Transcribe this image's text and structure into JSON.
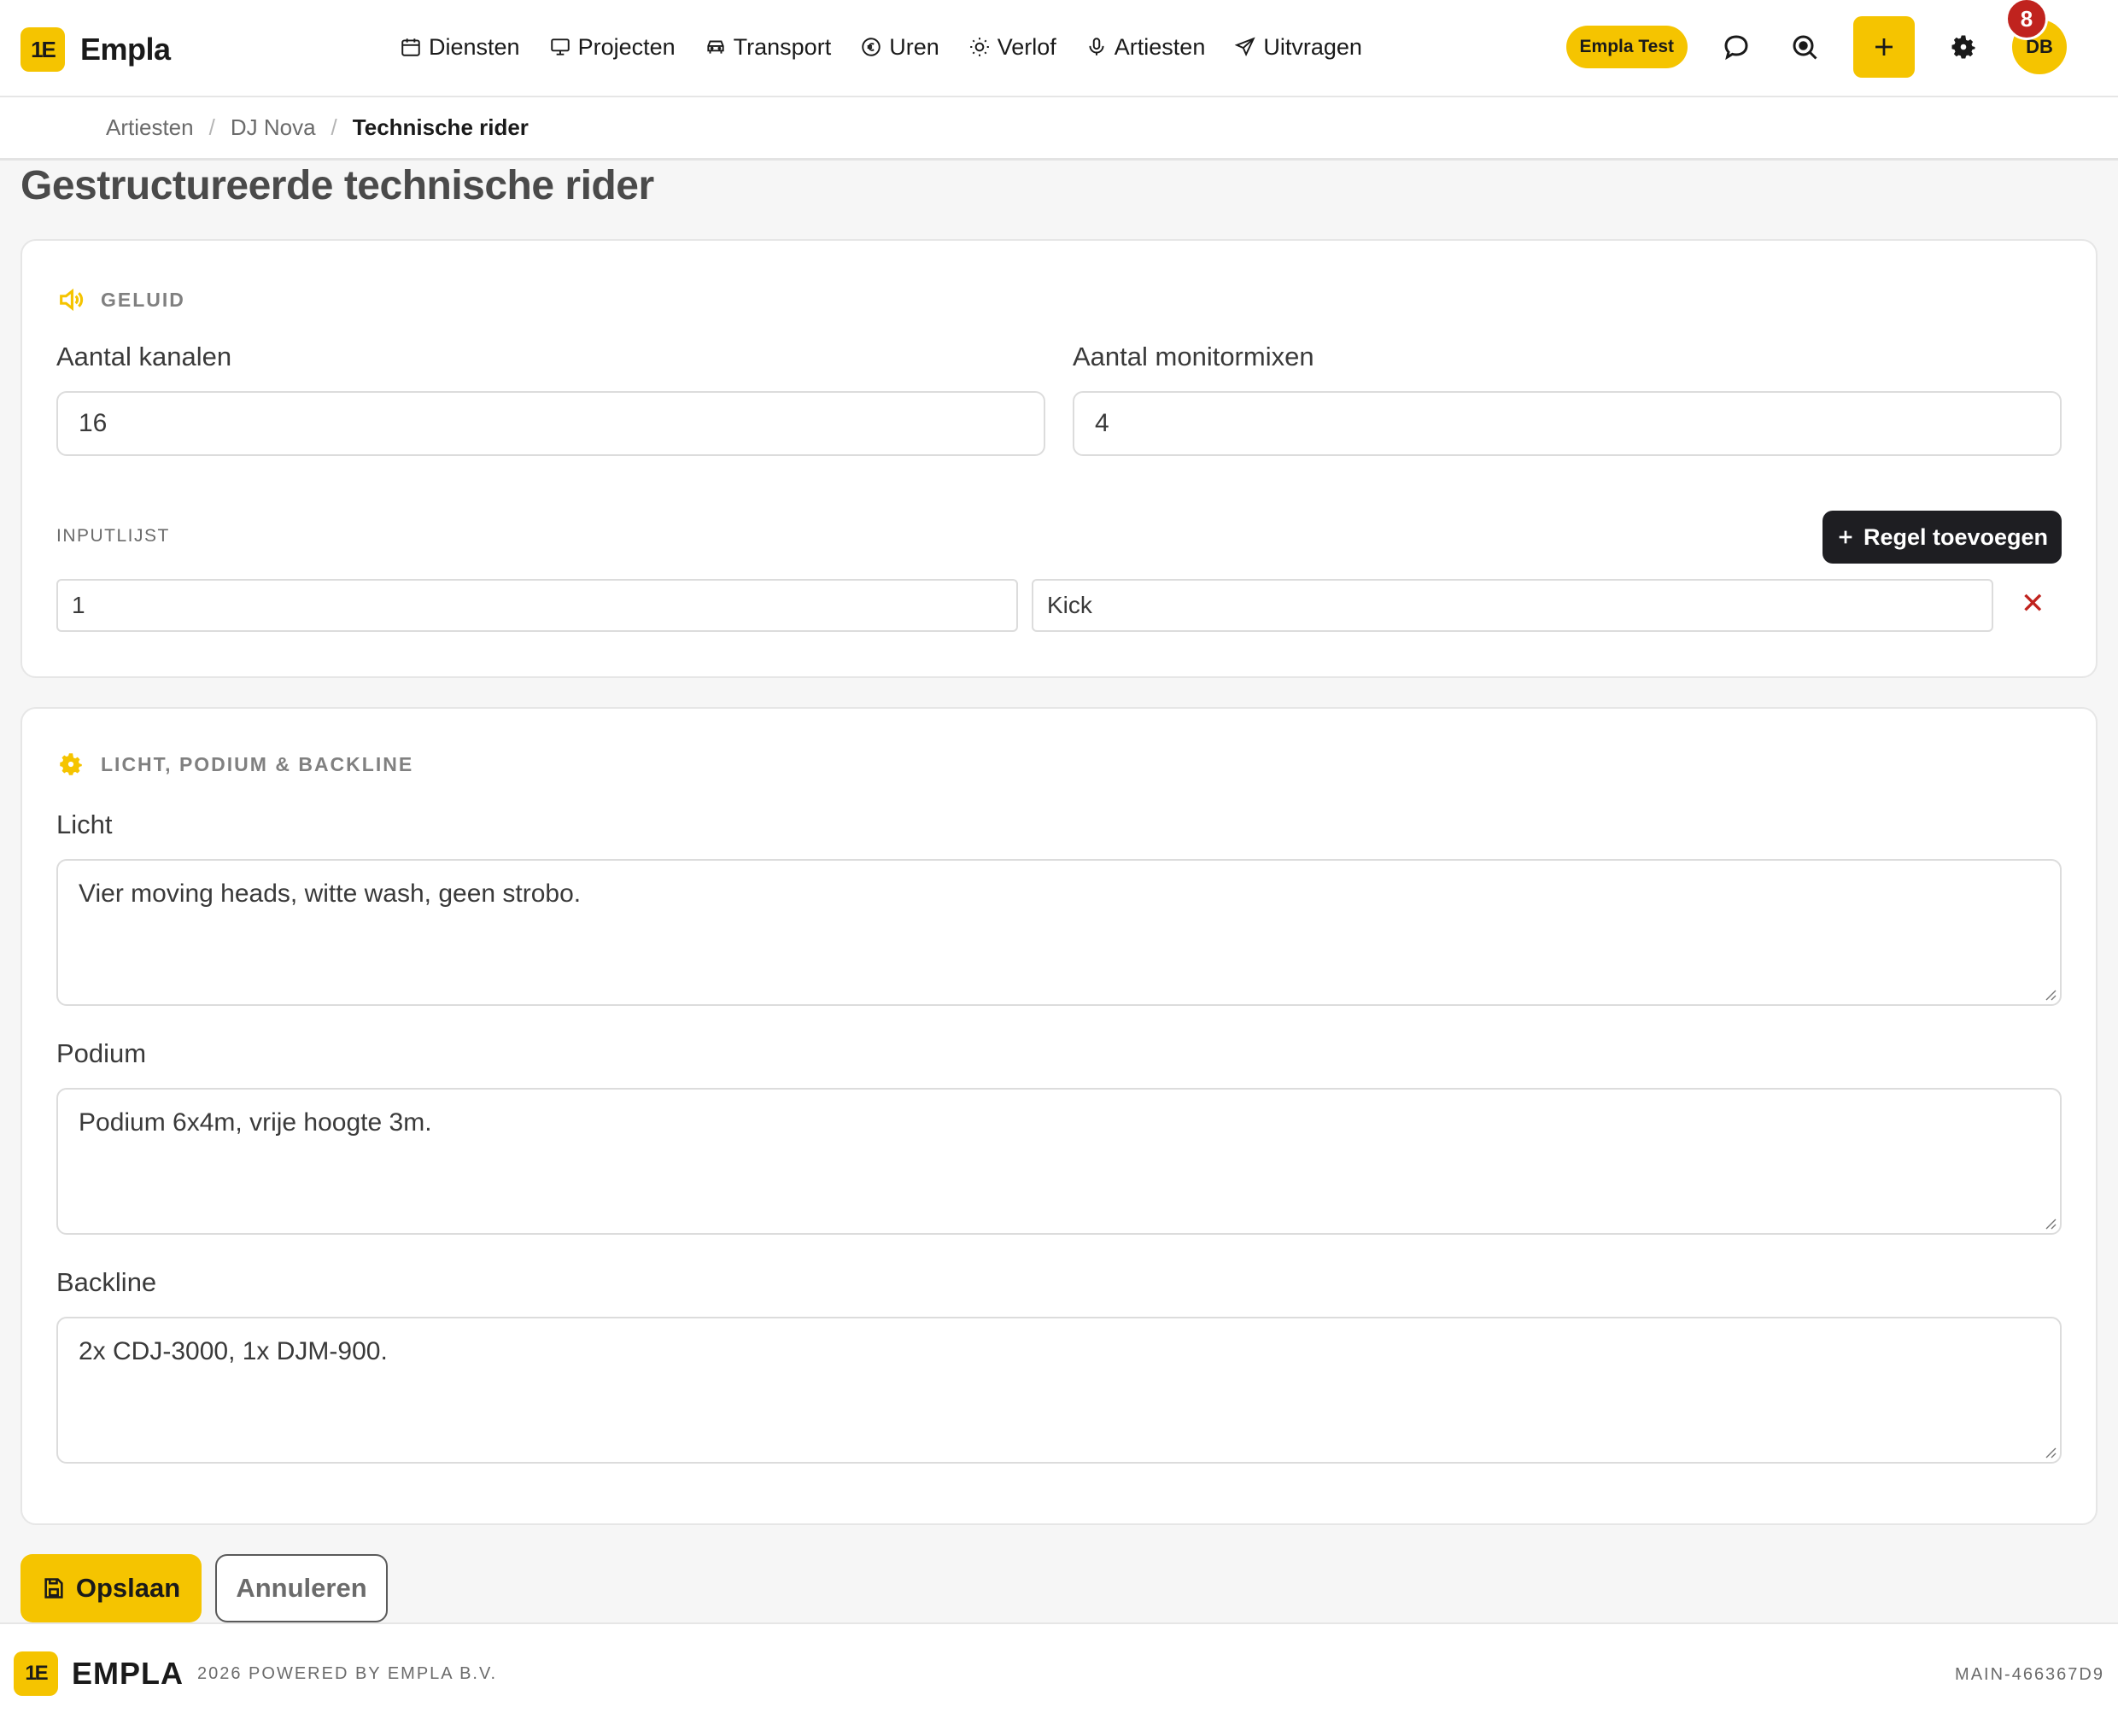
{
  "app": {
    "logo_text": "1E",
    "name": "Empla",
    "accent_color": "#f5c400"
  },
  "nav": {
    "items": [
      {
        "label": "Diensten",
        "icon": "calendar-icon"
      },
      {
        "label": "Projecten",
        "icon": "monitor-icon"
      },
      {
        "label": "Transport",
        "icon": "car-icon"
      },
      {
        "label": "Uren",
        "icon": "euro-icon"
      },
      {
        "label": "Verlof",
        "icon": "sun-icon"
      },
      {
        "label": "Artiesten",
        "icon": "microphone-icon"
      },
      {
        "label": "Uitvragen",
        "icon": "send-icon"
      }
    ],
    "tenant": "Empla Test",
    "notification_count": "8",
    "avatar_initials": "DB"
  },
  "breadcrumb": {
    "items": [
      "Artiesten",
      "DJ Nova",
      "Technische rider"
    ],
    "separator": "/"
  },
  "page": {
    "title": "Gestructureerde technische rider"
  },
  "sound": {
    "section_title": "GELUID",
    "channels_label": "Aantal kanalen",
    "channels_value": "16",
    "monitor_label": "Aantal monitormixen",
    "monitor_value": "4",
    "inputlist_label": "INPUTLIJST",
    "add_row_label": "Regel toevoegen",
    "rows": [
      {
        "channel": "1",
        "name": "Kick"
      }
    ],
    "remove_symbol": "✕"
  },
  "stage": {
    "section_title": "LICHT, PODIUM & BACKLINE",
    "light_label": "Licht",
    "light_value": "Vier moving heads, witte wash, geen strobo.",
    "podium_label": "Podium",
    "podium_value": "Podium 6x4m, vrije hoogte 3m.",
    "backline_label": "Backline",
    "backline_value": "2x CDJ-3000, 1x DJM-900."
  },
  "actions": {
    "save_label": "Opslaan",
    "cancel_label": "Annuleren"
  },
  "footer": {
    "logo_text": "1E",
    "brand": "EMPLA",
    "powered": "2026 POWERED BY EMPLA B.V.",
    "build": "MAIN-466367D9"
  }
}
